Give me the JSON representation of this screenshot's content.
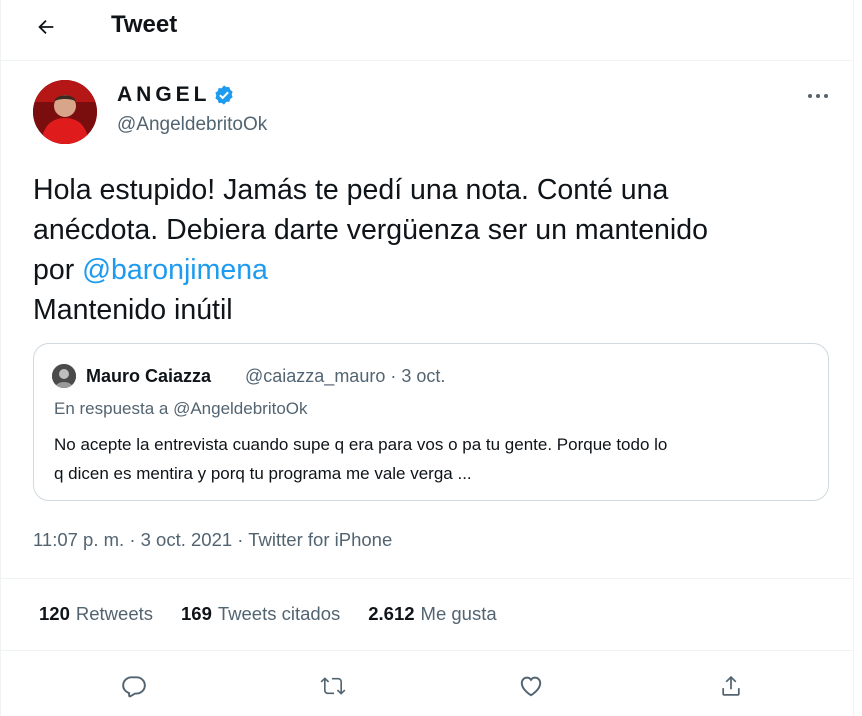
{
  "header": {
    "title": "Tweet",
    "back_icon": "arrow-left-icon"
  },
  "tweet": {
    "author_name": "ANGEL",
    "author_handle": "@AngeldebritoOk",
    "text_line1": "Hola estupido! Jamás te pedí una nota. Conté una",
    "text_line2": "anécdota. Debiera darte vergüenza ser un mantenido",
    "text_line3_prefix": "por ",
    "mention": "@baronjimena",
    "text_line4": "Mantenido inútil",
    "more_icon": "more-dots-icon"
  },
  "quote": {
    "name": "Mauro Caiazza",
    "handle_date": "@caiazza_mauro · 3 oct.",
    "reply_to": "En respuesta a @AngeldebritoOk",
    "text_line1": "No acepte la entrevista cuando supe q era para vos o pa tu gente. Porque todo lo",
    "text_line2": "q dicen es mentira y porq tu programa me vale verga ..."
  },
  "meta": {
    "time_date": "11:07 p. m. · 3 oct. 2021 · ",
    "source": "Twitter for iPhone"
  },
  "stats": [
    {
      "count": "120",
      "label": "Retweets"
    },
    {
      "count": "169",
      "label": "Tweets citados"
    },
    {
      "count": "2.612",
      "label": "Me gusta"
    }
  ],
  "actions": [
    "reply-icon",
    "retweet-icon",
    "like-icon",
    "share-icon"
  ],
  "colors": {
    "accent": "#1d9bf0",
    "secondary_text": "#536471",
    "border": "#cfd9de"
  }
}
